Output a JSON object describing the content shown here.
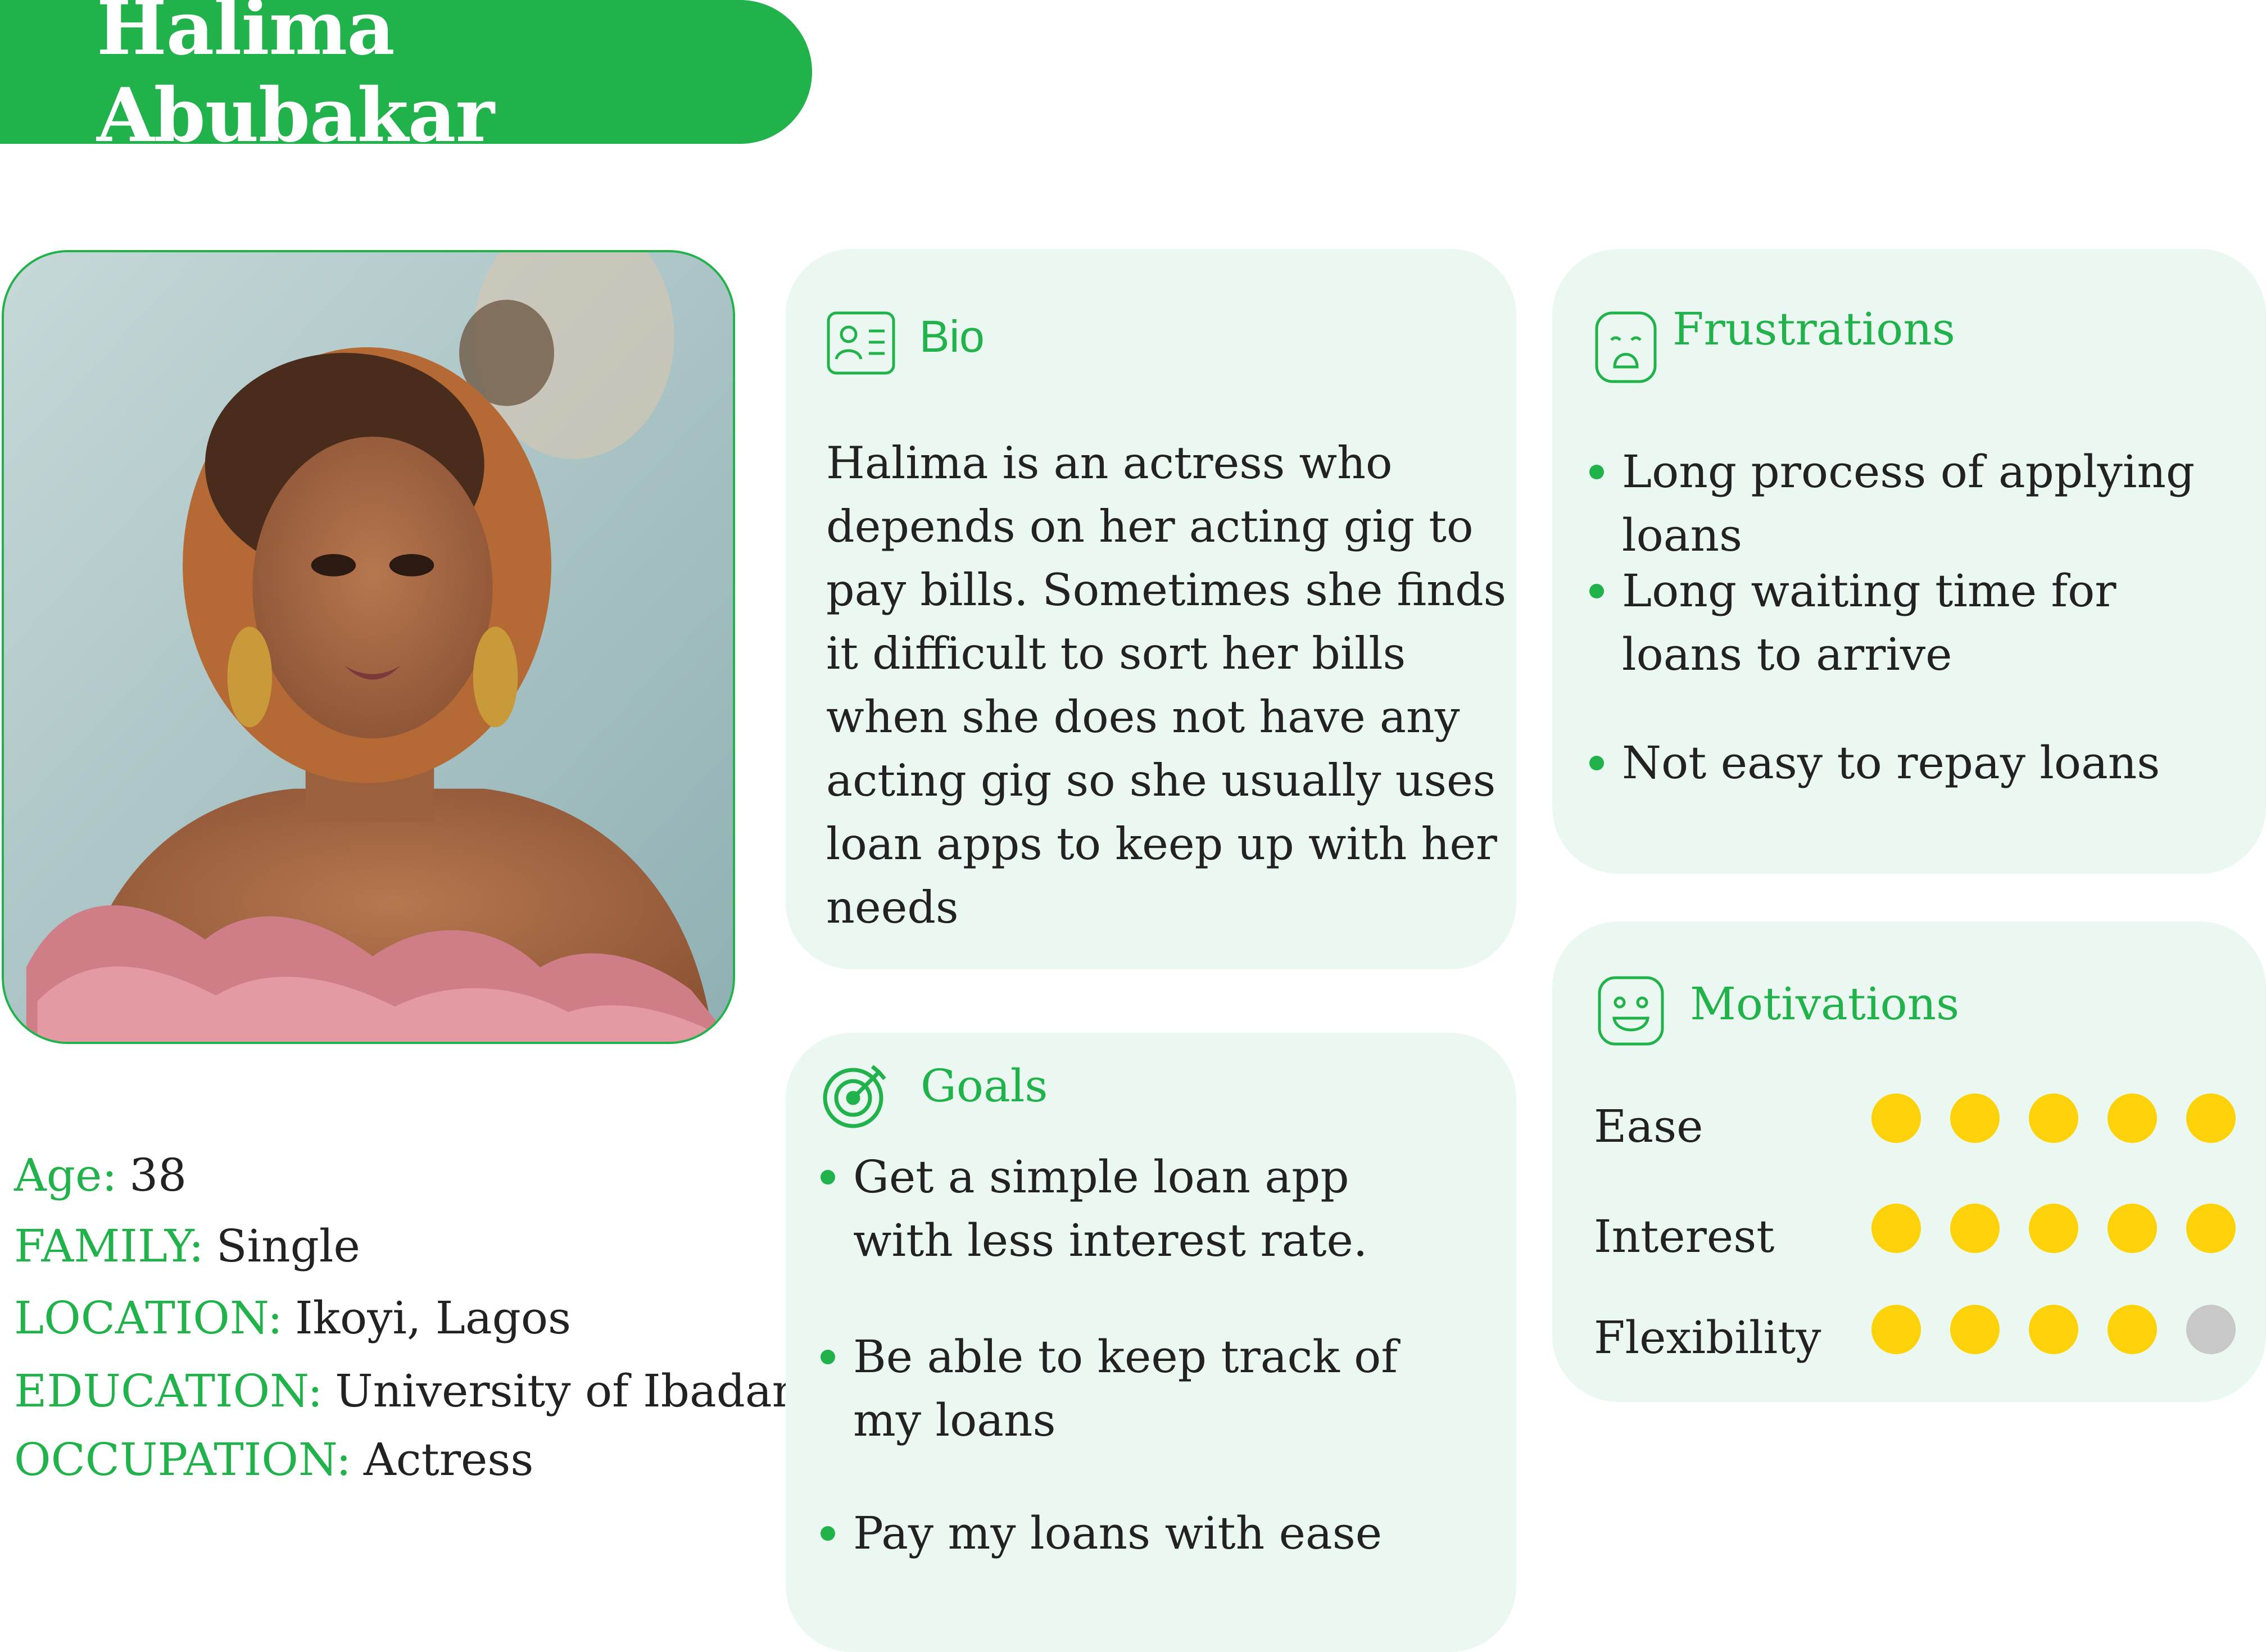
{
  "persona_name": "Halima Abubakar",
  "details": [
    {
      "label": "Age:",
      "value": "38"
    },
    {
      "label": "FAMILY:",
      "value": "Single"
    },
    {
      "label": "LOCATION:",
      "value": "Ikoyi, Lagos"
    },
    {
      "label": "EDUCATION:",
      "value": "University of Ibadan"
    },
    {
      "label": "OCCUPATION:",
      "value": "Actress"
    }
  ],
  "bio": {
    "title": "Bio",
    "icon": "id-card-icon",
    "text": "Halima is an actress who depends on her acting gig to pay bills. Sometimes she finds it difficult to sort her bills when she does not have any acting gig so she usually uses loan apps to keep up with her needs"
  },
  "frustrations": {
    "title": "Frustrations",
    "icon": "sad-face-icon",
    "items": [
      "Long process of applying loans",
      "Long waiting time for loans to arrive",
      "Not easy to repay loans"
    ]
  },
  "goals": {
    "title": "Goals",
    "icon": "target-icon",
    "items": [
      "Get a simple loan app with less interest rate.",
      "Be able to keep track of my loans",
      "Pay my loans with ease"
    ]
  },
  "motivations": {
    "title": "Motivations",
    "icon": "happy-face-icon",
    "scale_max": 5,
    "items": [
      {
        "label": "Ease",
        "level": 5
      },
      {
        "label": "Interest",
        "level": 5
      },
      {
        "label": "Flexibility",
        "level": 4
      }
    ]
  },
  "colors": {
    "brand_green": "#22b24c",
    "card_bg": "#ebf8f1",
    "rating_on": "#fdd20b",
    "rating_off": "#c8c8c8"
  }
}
